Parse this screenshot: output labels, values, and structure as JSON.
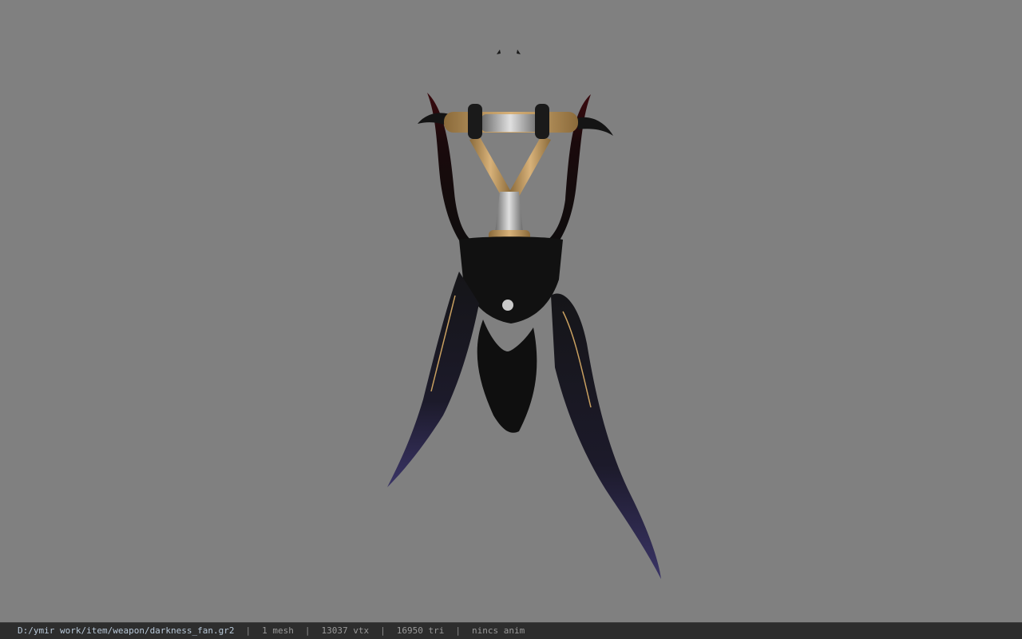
{
  "viewer": {
    "background_color": "#808080",
    "model_subject": "darkness fan weapon model"
  },
  "status_bar": {
    "file_path": "D:/ymir work/item/weapon/darkness_fan.gr2",
    "separator": "|",
    "mesh_count": "1 mesh",
    "vertex_count": "13037 vtx",
    "triangle_count": "16950 tri",
    "anim_label": "nincs anim"
  }
}
